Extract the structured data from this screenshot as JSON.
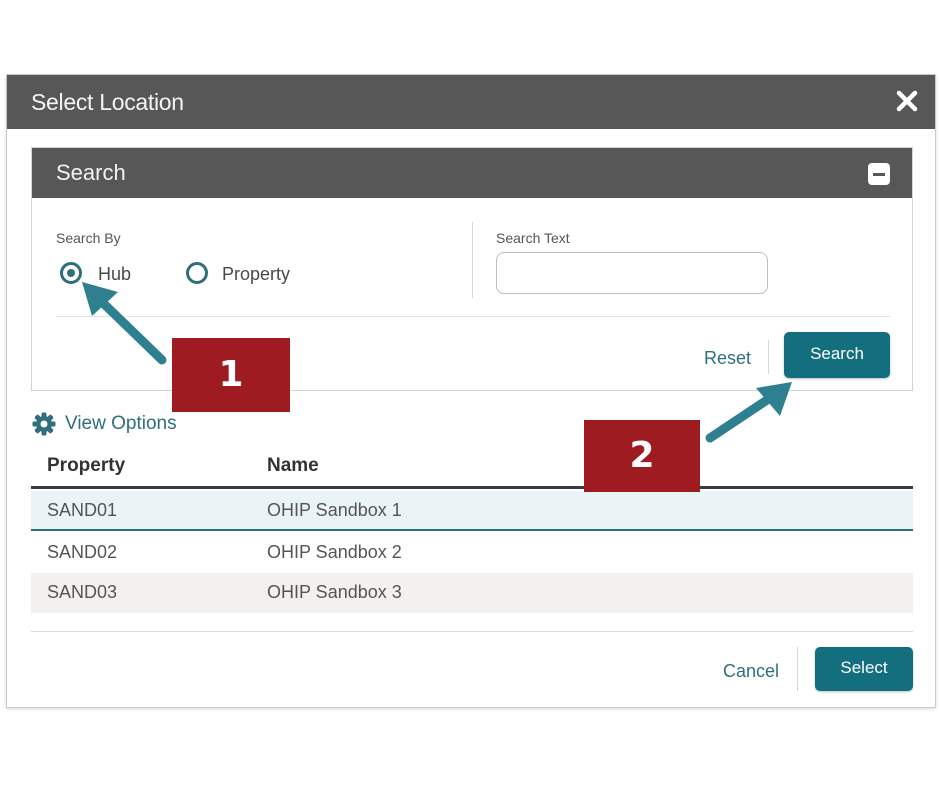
{
  "dialog": {
    "title": "Select Location",
    "close_icon": "close-icon"
  },
  "search_panel": {
    "title": "Search",
    "collapse_icon": "minus-icon",
    "search_by_label": "Search By",
    "options": [
      {
        "label": "Hub",
        "checked": true
      },
      {
        "label": "Property",
        "checked": false
      }
    ],
    "search_text_label": "Search Text",
    "search_text_value": "",
    "reset_label": "Reset",
    "search_button_label": "Search"
  },
  "view_options": {
    "icon": "gear-icon",
    "label": "View Options"
  },
  "table": {
    "columns": [
      "Property",
      "Name"
    ],
    "rows": [
      {
        "property": "SAND01",
        "name": "OHIP Sandbox 1",
        "selected": true
      },
      {
        "property": "SAND02",
        "name": "OHIP Sandbox 2",
        "selected": false
      },
      {
        "property": "SAND03",
        "name": "OHIP Sandbox 3",
        "selected": false
      }
    ]
  },
  "footer": {
    "cancel_label": "Cancel",
    "select_label": "Select"
  },
  "annotations": [
    {
      "label": "1"
    },
    {
      "label": "2"
    }
  ],
  "colors": {
    "titlebar": "#575757",
    "accent_teal": "#136f7d",
    "callout_red": "#9e1b22",
    "arrow_teal": "#2e7f8f"
  }
}
